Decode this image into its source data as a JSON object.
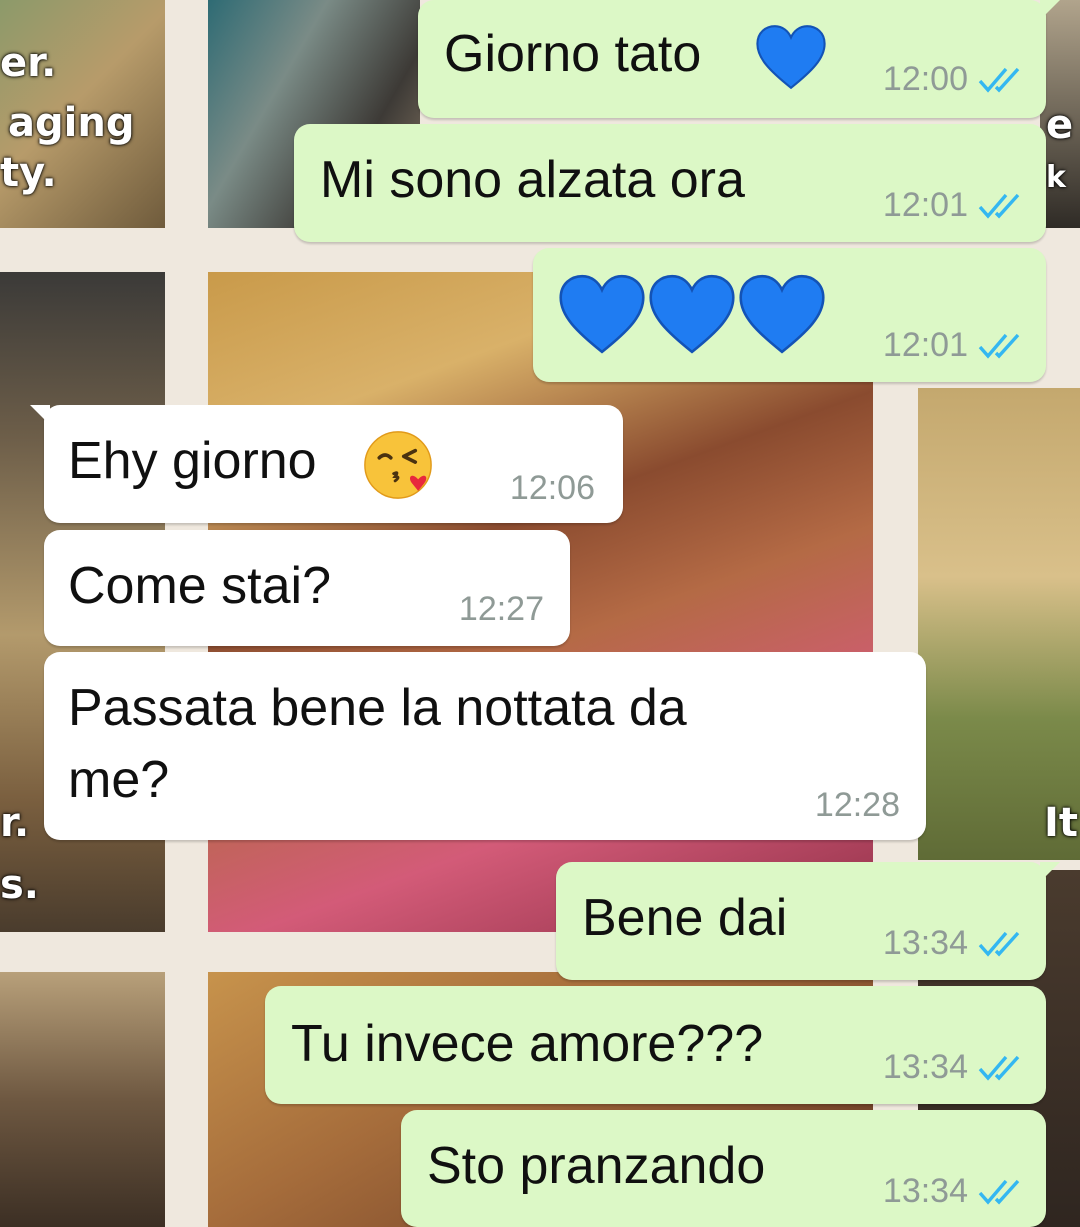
{
  "wallpaper": {
    "fragments": [
      "er.",
      "aging",
      "ty.",
      "e",
      "k",
      "r.",
      "s.",
      "It"
    ]
  },
  "colors": {
    "outgoing_bubble": "#dcf8c6",
    "incoming_bubble": "#ffffff",
    "read_ticks": "#34b7f1",
    "timestamp": "#8f9a96",
    "heart": "#1f7cf2"
  },
  "messages": [
    {
      "direction": "outgoing",
      "text": "Giorno tato",
      "emoji": [
        "blue-heart-icon"
      ],
      "time": "12:00",
      "status": "read"
    },
    {
      "direction": "outgoing",
      "text": "Mi sono alzata ora",
      "time": "12:01",
      "status": "read"
    },
    {
      "direction": "outgoing",
      "text": "",
      "emoji": [
        "blue-heart-icon",
        "blue-heart-icon",
        "blue-heart-icon"
      ],
      "time": "12:01",
      "status": "read"
    },
    {
      "direction": "incoming",
      "text": "Ehy giorno",
      "emoji": [
        "face-blowing-kiss-icon"
      ],
      "time": "12:06"
    },
    {
      "direction": "incoming",
      "text": "Come stai?",
      "time": "12:27"
    },
    {
      "direction": "incoming",
      "text_line1": "Passata bene la nottata da",
      "text_line2": "me?",
      "time": "12:28"
    },
    {
      "direction": "outgoing",
      "text": "Bene dai",
      "time": "13:34",
      "status": "read"
    },
    {
      "direction": "outgoing",
      "text": "Tu invece amore???",
      "time": "13:34",
      "status": "read"
    },
    {
      "direction": "outgoing",
      "text": "Sto pranzando",
      "time": "13:34",
      "status": "read"
    }
  ]
}
